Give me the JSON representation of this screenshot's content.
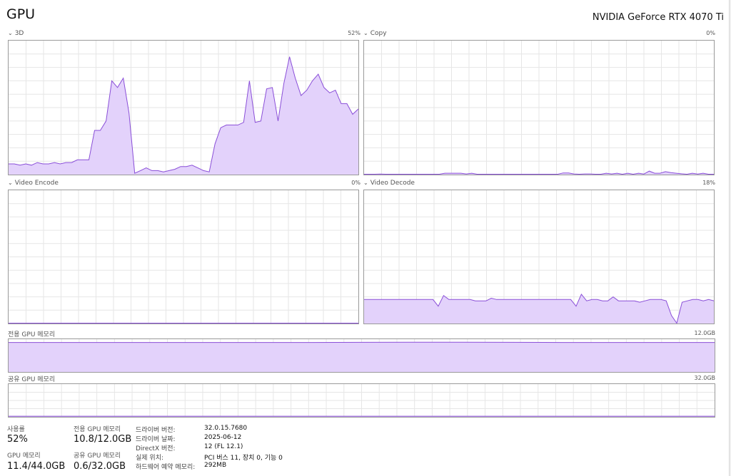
{
  "header": {
    "title": "GPU",
    "device": "NVIDIA GeForce RTX 4070 Ti"
  },
  "panels": {
    "p3d": {
      "label": "3D",
      "value": "52%"
    },
    "copy": {
      "label": "Copy",
      "value": "0%"
    },
    "encode": {
      "label": "Video Encode",
      "value": "0%"
    },
    "decode": {
      "label": "Video Decode",
      "value": "18%"
    },
    "dedicated": {
      "label": "전용 GPU 메모리",
      "value": "12.0GB"
    },
    "shared": {
      "label": "공유 GPU 메모리",
      "value": "32.0GB"
    }
  },
  "colors": {
    "line": "#8a4fd8",
    "fill": "#e3d2fb",
    "grid": "#e6e6e6",
    "border": "#9a9a9a"
  },
  "chart_data": [
    {
      "type": "area",
      "name": "3D",
      "ylim": [
        0,
        100
      ],
      "grid": true,
      "values": [
        8,
        8,
        7,
        8,
        7,
        9,
        8,
        8,
        9,
        8,
        9,
        9,
        11,
        11,
        11,
        33,
        33,
        40,
        70,
        65,
        72,
        46,
        1,
        3,
        5,
        3,
        3,
        2,
        3,
        4,
        6,
        6,
        7,
        5,
        3,
        2,
        23,
        35,
        37,
        37,
        37,
        39,
        70,
        39,
        40,
        64,
        65,
        40,
        68,
        88,
        72,
        59,
        63,
        70,
        75,
        65,
        61,
        63,
        53,
        53,
        45,
        49
      ]
    },
    {
      "type": "area",
      "name": "Copy",
      "ylim": [
        0,
        100
      ],
      "grid": true,
      "values": [
        0,
        0,
        0,
        0.4,
        0,
        0,
        0,
        0,
        0,
        0,
        0,
        0,
        0,
        0,
        0,
        1,
        1,
        1,
        1,
        0.5,
        1,
        0,
        0,
        0,
        0,
        0,
        0,
        0,
        0,
        0,
        0,
        0,
        0,
        0,
        0,
        0,
        0,
        1.2,
        1.2,
        0.5,
        0,
        0.5,
        0.5,
        0,
        0,
        1,
        0.5,
        1,
        0,
        1,
        0,
        1,
        0.4,
        2.6,
        1,
        1,
        2.2,
        1.5,
        1,
        0.6,
        0,
        1,
        0.4,
        1,
        0,
        0
      ]
    },
    {
      "type": "area",
      "name": "Video Encode",
      "ylim": [
        0,
        100
      ],
      "grid": true,
      "values": [
        0,
        0,
        0,
        0,
        0,
        0,
        0,
        0,
        0,
        0
      ]
    },
    {
      "type": "area",
      "name": "Video Decode",
      "ylim": [
        0,
        100
      ],
      "grid": true,
      "values": [
        18,
        18,
        18,
        18,
        18,
        18,
        18,
        18,
        18,
        18,
        18,
        18,
        18,
        18,
        13,
        21,
        18,
        18,
        18,
        18,
        18,
        17,
        17,
        17,
        19,
        18,
        18,
        18,
        18,
        18,
        18,
        18,
        18,
        18,
        18,
        18,
        18,
        18,
        18,
        18,
        13,
        22,
        17,
        18,
        18,
        17,
        17,
        20,
        17,
        17,
        17,
        17,
        16,
        17,
        18,
        18,
        18,
        17,
        6,
        0,
        16,
        17,
        18,
        18,
        17,
        18,
        17
      ]
    },
    {
      "type": "area",
      "name": "전용 GPU 메모리",
      "ylim": [
        0,
        12
      ],
      "grid": true,
      "values": [
        10.8,
        10.8,
        10.8,
        10.8,
        10.8,
        10.8,
        10.8,
        10.85,
        10.9,
        10.9,
        10.85,
        10.8,
        10.8,
        10.8,
        10.8
      ]
    },
    {
      "type": "area",
      "name": "공유 GPU 메모리",
      "ylim": [
        0,
        32
      ],
      "grid": true,
      "values": [
        0.6,
        0.6,
        0.6,
        0.6,
        0.6,
        0.6,
        0.6,
        0.6,
        0.6,
        0.6
      ]
    }
  ],
  "stats": {
    "usage_label": "사용률",
    "usage_value": "52%",
    "gpu_mem_label": "GPU 메모리",
    "gpu_mem_value": "11.4/44.0GB",
    "dedicated_label": "전용 GPU 메모리",
    "dedicated_value": "10.8/12.0GB",
    "shared_label": "공유 GPU 메모리",
    "shared_value": "0.6/32.0GB"
  },
  "info": [
    {
      "label": "드라이버 버전:",
      "value": "32.0.15.7680"
    },
    {
      "label": "드라이버 날짜:",
      "value": "2025-06-12"
    },
    {
      "label": "DirectX 버전:",
      "value": "12 (FL 12.1)"
    },
    {
      "label": "실제 위치:",
      "value": "PCI 버스 11, 장치 0, 기능 0"
    },
    {
      "label": "하드웨어 예약 메모리:",
      "value": "292MB"
    }
  ]
}
